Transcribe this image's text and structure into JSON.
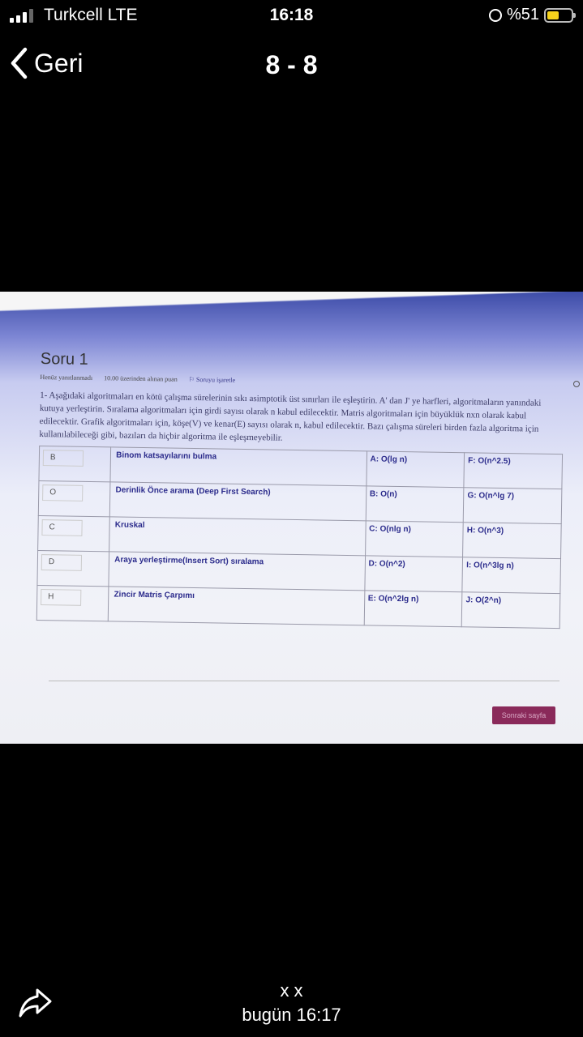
{
  "status": {
    "carrier": "Turkcell  LTE",
    "time": "16:18",
    "battery_text": "%51",
    "battery_level": 0.51,
    "battery_color": "#f6d31c"
  },
  "nav": {
    "back_label": "Geri",
    "title": "8 - 8"
  },
  "photo": {
    "question_title": "Soru 1",
    "meta": {
      "status": "Henüz yanıtlanmadı",
      "points": "10.00 üzerinden alınan puan",
      "flag": "Soruyu işaretle"
    },
    "question_text": "1- Aşağıdaki algoritmaları en kötü çalışma sürelerinin sıkı asimptotik üst sınırları ile eşleştirin. A' dan J' ye harfleri, algoritmaların yanındaki kutuya yerleştirin. Sıralama algoritmaları için girdi sayısı olarak n kabul edilecektir. Matris algoritmaları için büyüklük nxn olarak kabul edilecektir. Grafik algoritmaları için, köşe(V) ve kenar(E) sayısı olarak n, kabul edilecektir. Bazı çalışma süreleri birden fazla algoritma için kullanılabileceği gibi, bazıları da hiçbir algoritma ile eşleşmeyebilir.",
    "rows": [
      {
        "answer": "B",
        "algorithm": "Binom katsayılarını bulma",
        "opt1": "A: O(lg n)",
        "opt2": "F: O(n^2.5)"
      },
      {
        "answer": "O",
        "algorithm": "Derinlik Önce arama (Deep First Search)",
        "opt1": "B: O(n)",
        "opt2": "G: O(n^lg 7)"
      },
      {
        "answer": "C",
        "algorithm": "Kruskal",
        "opt1": "C: O(nlg n)",
        "opt2": "H: O(n^3)"
      },
      {
        "answer": "D",
        "algorithm": "Araya yerleştirme(Insert Sort) sıralama",
        "opt1": "D: O(n^2)",
        "opt2": "I: O(n^3lg n)"
      },
      {
        "answer": "H",
        "algorithm": "Zincir Matris Çarpımı",
        "opt1": "E: O(n^2lg n)",
        "opt2": "J: O(2^n)"
      }
    ],
    "next_button": "Sonraki sayfa"
  },
  "footer": {
    "sender": "x x",
    "timestamp": "bugün 16:17"
  }
}
